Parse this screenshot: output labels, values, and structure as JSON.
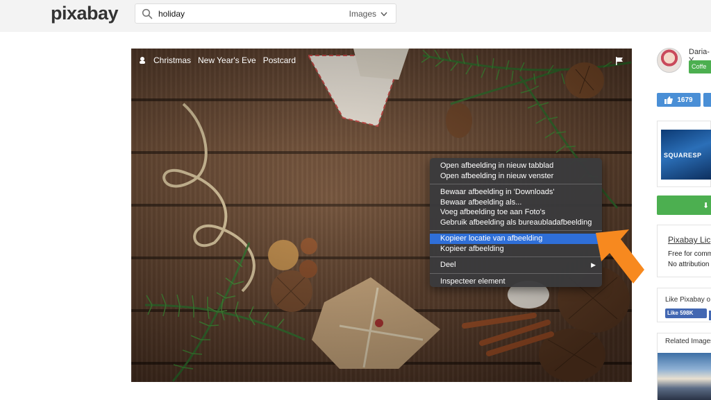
{
  "header": {
    "logo": "pixabay",
    "search_query": "holiday",
    "search_type": "Images"
  },
  "photo": {
    "tags": [
      "Christmas",
      "New Year's Eve",
      "Postcard"
    ]
  },
  "context_menu": {
    "groups": [
      [
        "Open afbeelding in nieuw tabblad",
        "Open afbeelding in nieuw venster"
      ],
      [
        "Bewaar afbeelding in 'Downloads'",
        "Bewaar afbeelding als...",
        "Voeg afbeelding toe aan Foto's",
        "Gebruik afbeelding als bureaubladafbeelding"
      ],
      [
        "Kopieer locatie van afbeelding",
        "Kopieer afbeelding"
      ],
      [
        "Deel"
      ],
      [
        "Inspecteer element"
      ]
    ],
    "highlighted": "Kopieer locatie van afbeelding",
    "highlight_color": "#2f6fd8"
  },
  "sidebar": {
    "user_name": "Daria-Y",
    "coffee_label": "Coffe",
    "like_count": "1679",
    "ad_text": "SQUARESP",
    "license_title": "Pixabay Lic",
    "license_line1": "Free for comm",
    "license_line2": "No attribution",
    "fb_text": "Like Pixabay o",
    "fb_button": "Like 598K",
    "related_title": "Related Images"
  },
  "colors": {
    "accent_green": "#4caf50",
    "like_blue": "#4a8fd6",
    "arrow_orange": "#f7891f"
  }
}
